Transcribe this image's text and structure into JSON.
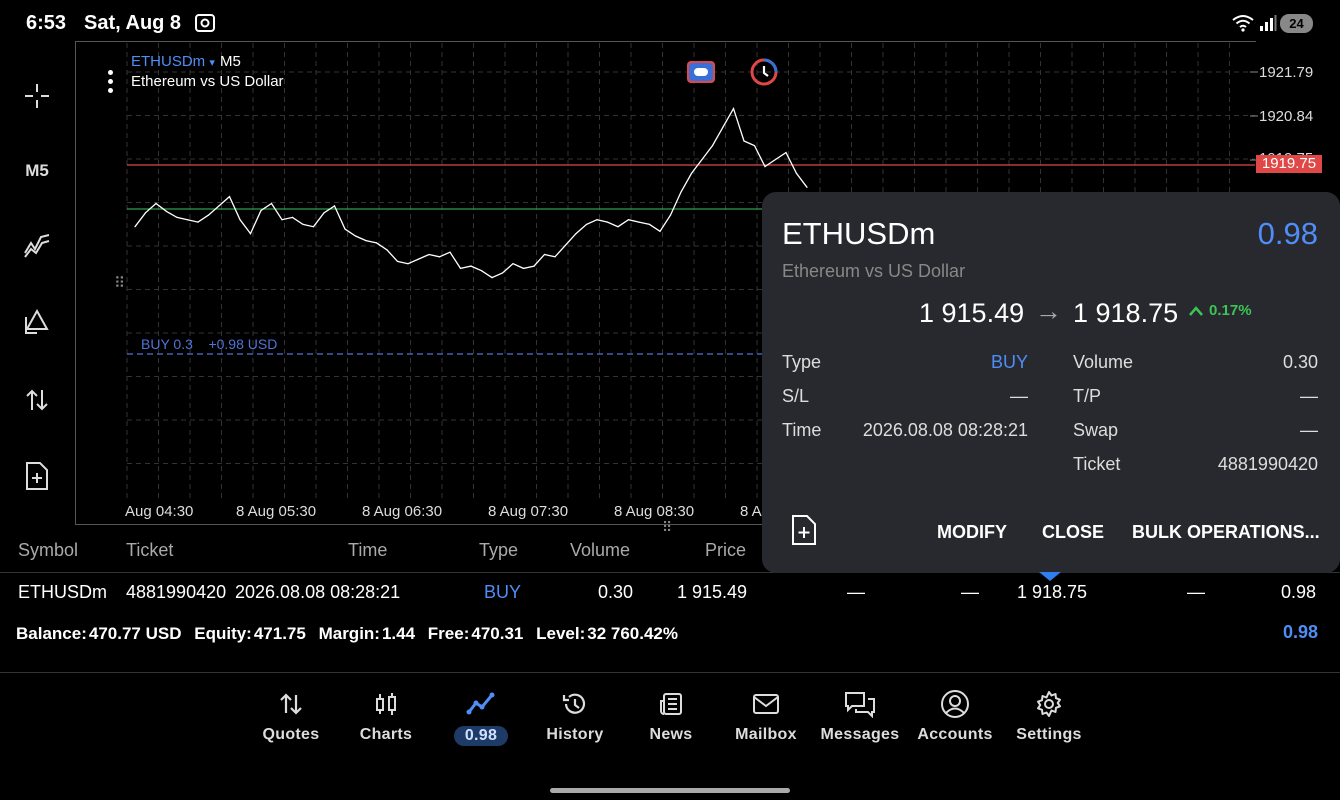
{
  "status_bar": {
    "time": "6:53",
    "date": "Sat, Aug 8",
    "battery": "24",
    "icons": [
      "screenshot-icon",
      "wifi-icon",
      "signal-icon"
    ]
  },
  "toolbar": {
    "timeframe_label": "M5",
    "icons": [
      "crosshair-icon",
      "indicators-icon",
      "objects-icon",
      "trade-arrows-icon",
      "new-order-icon"
    ]
  },
  "chart": {
    "symbol": "ETHUSDm",
    "symbol_caret": "▾",
    "timeframe": "M5",
    "description": "Ethereum vs US Dollar",
    "price_labels": [
      "1921.79",
      "1920.84",
      "1919.75"
    ],
    "current_price_tag": "1919.75",
    "time_labels": [
      "Aug 04:30",
      "8 Aug 05:30",
      "8 Aug 06:30",
      "8 Aug 07:30",
      "8 Aug 08:30",
      "8 A"
    ],
    "buy_line_label": "BUY 0.3    +0.98 USD",
    "colors": {
      "bid_line": "#e04848",
      "ask_line": "#2f9e4f",
      "buy_line": "#4f74d9",
      "price_line": "#ffffff"
    }
  },
  "chart_data": {
    "type": "line",
    "title": "ETHUSDm",
    "xlabel": "",
    "ylabel": "",
    "ylim": [
      1916.4,
      1922.0
    ],
    "series": [
      {
        "name": "ETHUSDm",
        "x": [
          "04:25",
          "04:30",
          "04:35",
          "04:40",
          "04:45",
          "04:50",
          "04:55",
          "05:00",
          "05:05",
          "05:10",
          "05:15",
          "05:20",
          "05:25",
          "05:30",
          "05:35",
          "05:40",
          "05:45",
          "05:50",
          "05:55",
          "06:00",
          "06:05",
          "06:10",
          "06:15",
          "06:20",
          "06:25",
          "06:30",
          "06:35",
          "06:40",
          "06:45",
          "06:50",
          "06:55",
          "07:00",
          "07:05",
          "07:10",
          "07:15",
          "07:20",
          "07:25",
          "07:30",
          "07:35",
          "07:40",
          "07:45",
          "07:50",
          "07:55",
          "08:00",
          "08:05",
          "08:10",
          "08:15",
          "08:20",
          "08:25",
          "08:30",
          "08:35",
          "08:40",
          "08:45",
          "08:50",
          "08:55",
          "09:00",
          "09:05",
          "09:10",
          "09:15",
          "09:20",
          "09:25",
          "09:30",
          "09:35",
          "09:40",
          "09:45"
        ],
        "values": [
          1918.45,
          1918.75,
          1918.95,
          1918.78,
          1918.65,
          1918.6,
          1918.55,
          1918.7,
          1918.9,
          1919.1,
          1918.6,
          1918.3,
          1918.8,
          1918.95,
          1918.6,
          1918.65,
          1918.5,
          1918.45,
          1918.75,
          1918.9,
          1918.4,
          1918.25,
          1918.15,
          1918.1,
          1917.95,
          1917.7,
          1917.65,
          1917.75,
          1917.85,
          1917.8,
          1917.9,
          1917.55,
          1917.6,
          1917.5,
          1917.35,
          1917.45,
          1917.65,
          1917.55,
          1917.6,
          1917.85,
          1917.8,
          1918.05,
          1918.3,
          1918.5,
          1918.6,
          1918.55,
          1918.45,
          1918.6,
          1918.55,
          1918.5,
          1918.35,
          1918.7,
          1919.2,
          1919.6,
          1919.9,
          1920.2,
          1920.6,
          1921.0,
          1920.3,
          1920.2,
          1919.75,
          1919.9,
          1920.05,
          1919.6,
          1919.3
        ]
      }
    ]
  },
  "popup": {
    "symbol": "ETHUSDm",
    "profit": "0.98",
    "description": "Ethereum vs US Dollar",
    "open_price": "1 915.49",
    "arrow": "→",
    "current_price": "1 918.75",
    "change": "0.17%",
    "fields_left": [
      {
        "label": "Type",
        "value": "BUY"
      },
      {
        "label": "S/L",
        "value": "—"
      },
      {
        "label": "Time",
        "value": "2026.08.08 08:28:21"
      }
    ],
    "fields_right": [
      {
        "label": "Volume",
        "value": "0.30"
      },
      {
        "label": "T/P",
        "value": "—"
      },
      {
        "label": "Swap",
        "value": "—"
      },
      {
        "label": "Ticket",
        "value": "4881990420"
      }
    ],
    "buttons": {
      "modify": "MODIFY",
      "close": "CLOSE",
      "bulk": "BULK OPERATIONS..."
    }
  },
  "positions": {
    "headers": [
      "Symbol",
      "Ticket",
      "Time",
      "Type",
      "Volume",
      "Price"
    ],
    "row": {
      "symbol": "ETHUSDm",
      "ticket": "4881990420",
      "time": "2026.08.08 08:28:21",
      "type": "BUY",
      "volume": "0.30",
      "price": "1 915.49",
      "sl": "—",
      "tp": "—",
      "current": "1 918.75",
      "swap": "—",
      "profit": "0.98"
    },
    "balance": {
      "balance_label": "Balance:",
      "balance": "470.77 USD",
      "equity_label": "Equity:",
      "equity": "471.75",
      "margin_label": "Margin:",
      "margin": "1.44",
      "free_label": "Free:",
      "free": "470.31",
      "level_label": "Level:",
      "level": "32 760.42%",
      "total_profit": "0.98"
    }
  },
  "bottom_nav": [
    {
      "label": "Quotes",
      "icon": "quotes-icon"
    },
    {
      "label": "Charts",
      "icon": "charts-icon"
    },
    {
      "label": "0.98",
      "icon": "trade-icon"
    },
    {
      "label": "History",
      "icon": "history-icon"
    },
    {
      "label": "News",
      "icon": "news-icon"
    },
    {
      "label": "Mailbox",
      "icon": "mailbox-icon"
    },
    {
      "label": "Messages",
      "icon": "messages-icon"
    },
    {
      "label": "Accounts",
      "icon": "accounts-icon"
    },
    {
      "label": "Settings",
      "icon": "settings-icon"
    }
  ]
}
